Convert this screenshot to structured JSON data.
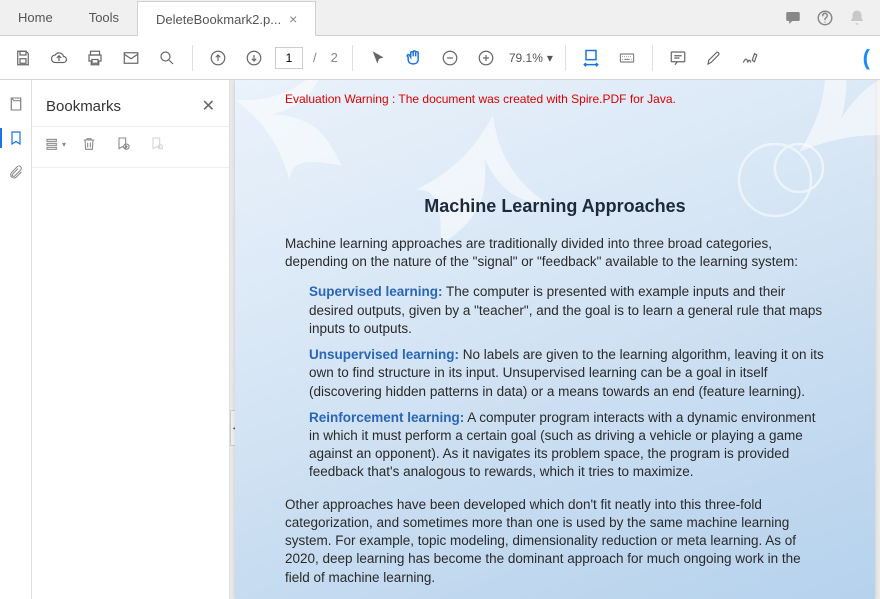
{
  "tabs": {
    "home": "Home",
    "tools": "Tools",
    "file": "DeleteBookmark2.p..."
  },
  "toolbar": {
    "page_current": "1",
    "page_total": "2",
    "page_sep": "/",
    "zoom": "79.1%"
  },
  "panel": {
    "title": "Bookmarks"
  },
  "document": {
    "eval_warning": "Evaluation Warning : The document was created with Spire.PDF for Java.",
    "title": "Machine Learning Approaches",
    "intro": "Machine learning approaches are traditionally divided into three broad categories, depending on the nature of the \"signal\" or \"feedback\" available to the learning system:",
    "items": [
      {
        "term": "Supervised learning:",
        "text": " The computer is presented with example inputs and their desired outputs, given by a \"teacher\", and the goal is to learn a general rule that maps inputs to outputs."
      },
      {
        "term": "Unsupervised learning:",
        "text": " No labels are given to the learning algorithm, leaving it on its own to find structure in its input. Unsupervised learning can be a goal in itself (discovering hidden patterns in data) or a means towards an end (feature learning)."
      },
      {
        "term": "Reinforcement learning:",
        "text": " A computer program interacts with a dynamic environment in which it must perform a certain goal (such as driving a vehicle or playing a game against an opponent). As it navigates its problem space, the program is provided feedback that's analogous to rewards, which it tries to maximize."
      }
    ],
    "footer": "Other approaches have been developed which don't fit neatly into this three-fold categorization, and sometimes more than one is used by the same machine learning system. For example, topic modeling, dimensionality reduction or meta learning. As of 2020, deep learning has become the dominant approach for much ongoing work in the field of machine learning."
  }
}
